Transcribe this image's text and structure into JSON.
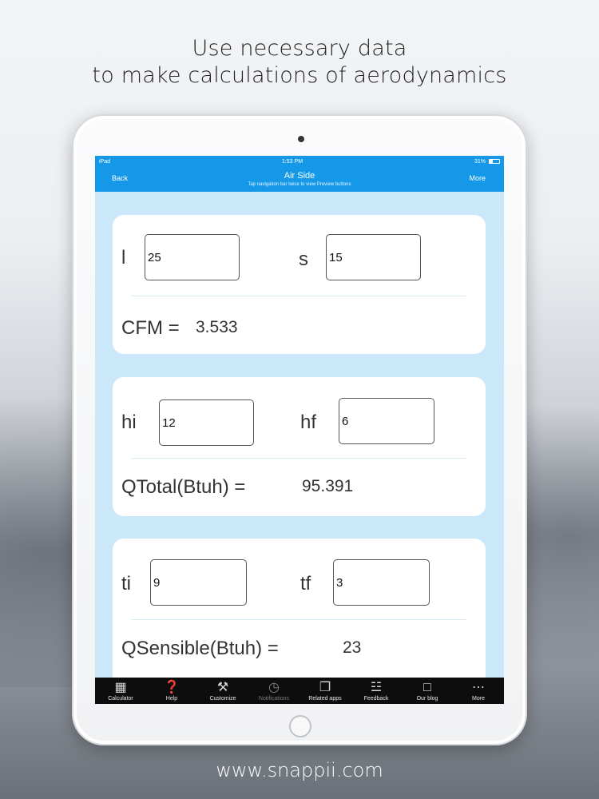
{
  "promo": {
    "headline_line1": "Use necessary data",
    "headline_line2": "to make calculations of aerodynamics",
    "footer": "www.snappii.com"
  },
  "status_bar": {
    "device": "iPad",
    "time": "1:53 PM",
    "battery": "31%"
  },
  "nav": {
    "back_label": "Back",
    "title": "Air Side",
    "subtitle": "Tap navigation bar twice to view Preview buttons",
    "more_label": "More"
  },
  "cards": [
    {
      "field1": {
        "label": "l",
        "value": "25"
      },
      "field2": {
        "label": "s",
        "value": "15"
      },
      "result": {
        "label": "CFM =",
        "value": "3.533"
      }
    },
    {
      "field1": {
        "label": "hi",
        "value": "12"
      },
      "field2": {
        "label": "hf",
        "value": "6"
      },
      "result": {
        "label": "QTotal(Btuh) =",
        "value": "95.391"
      }
    },
    {
      "field1": {
        "label": "ti",
        "value": "9"
      },
      "field2": {
        "label": "tf",
        "value": "3"
      },
      "result": {
        "label": "QSensible(Btuh) =",
        "value": "23"
      }
    }
  ],
  "tabbar": {
    "items": [
      {
        "label": "Calculator",
        "icon": "calculator-icon"
      },
      {
        "label": "Help",
        "icon": "help-icon"
      },
      {
        "label": "Customize",
        "icon": "tools-icon"
      },
      {
        "label": "Notifications",
        "icon": "notifications-icon"
      },
      {
        "label": "Related apps",
        "icon": "related-apps-icon"
      },
      {
        "label": "Feedback",
        "icon": "feedback-icon"
      },
      {
        "label": "Our blog",
        "icon": "blog-icon"
      },
      {
        "label": "More",
        "icon": "more-icon"
      }
    ]
  },
  "colors": {
    "nav_blue": "#1598e8",
    "content_bg": "#cbe8fa",
    "tabbar_bg": "#0d0d0d"
  }
}
